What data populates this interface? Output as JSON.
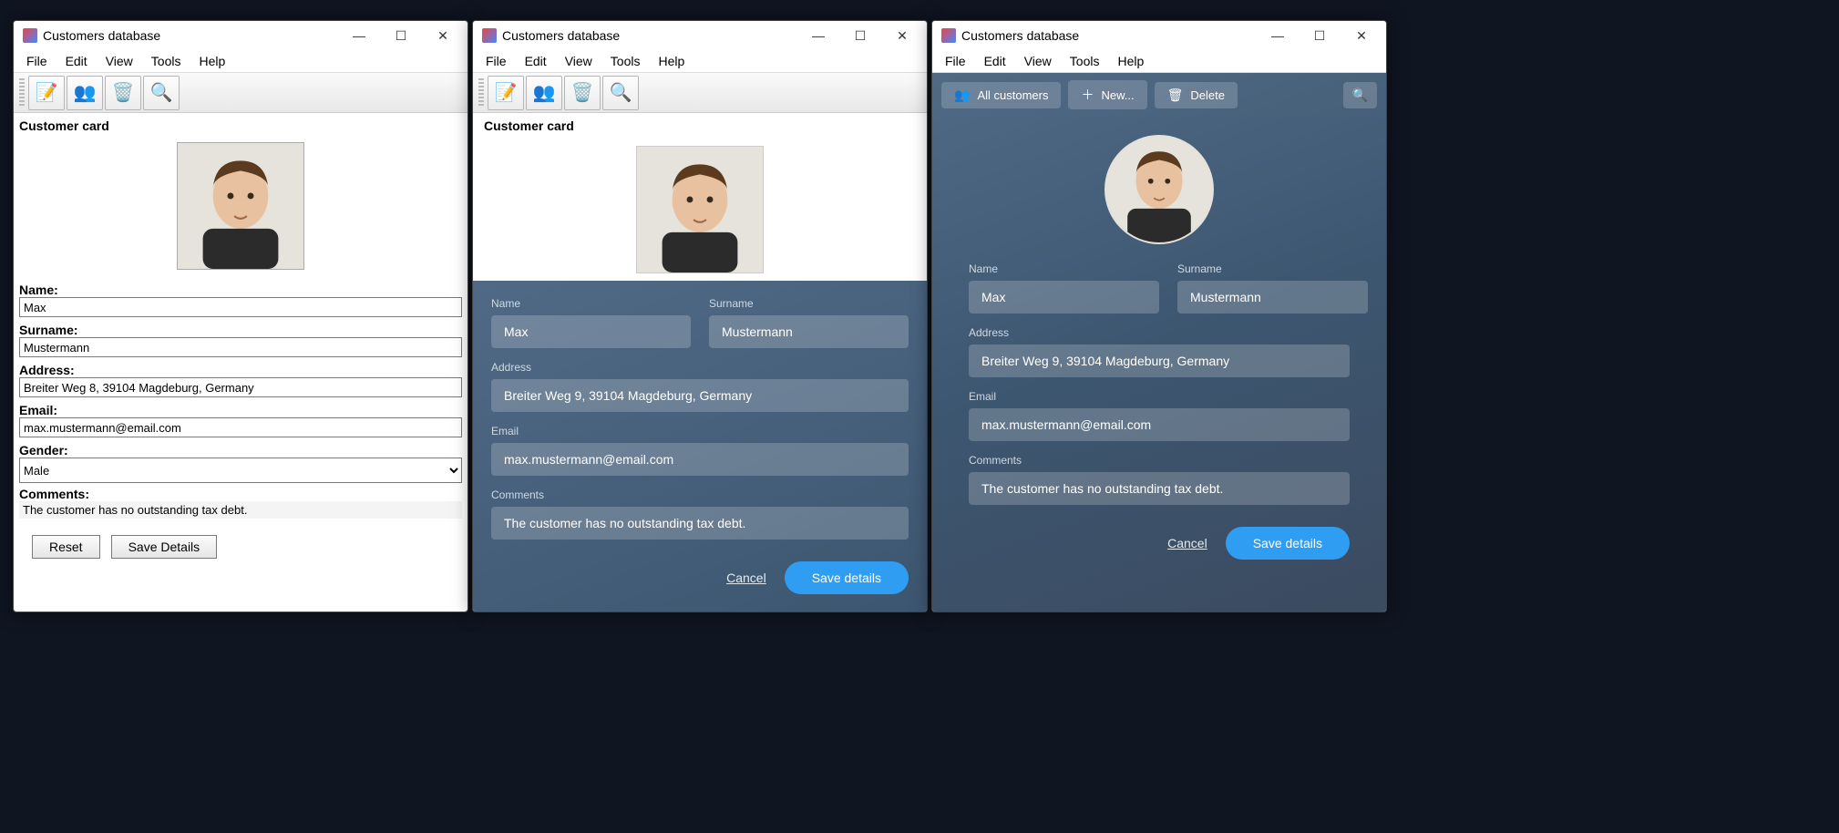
{
  "window_title": "Customers database",
  "menu": {
    "file": "File",
    "edit": "Edit",
    "view": "View",
    "tools": "Tools",
    "help": "Help"
  },
  "classic": {
    "section": "Customer card",
    "labels": {
      "name": "Name:",
      "surname": "Surname:",
      "address": "Address:",
      "email": "Email:",
      "gender": "Gender:",
      "comments": "Comments:"
    },
    "values": {
      "name": "Max",
      "surname": "Mustermann",
      "address": "Breiter Weg 8, 39104 Magdeburg, Germany",
      "email": "max.mustermann@email.com",
      "gender": "Male",
      "comments": "The customer has no outstanding tax debt."
    },
    "buttons": {
      "reset": "Reset",
      "save": "Save Details"
    }
  },
  "modern": {
    "section": "Customer card",
    "labels": {
      "name": "Name",
      "surname": "Surname",
      "address": "Address",
      "email": "Email",
      "comments": "Comments"
    },
    "values": {
      "name": "Max",
      "surname": "Mustermann",
      "address": "Breiter Weg 9, 39104 Magdeburg, Germany",
      "email": "max.mustermann@email.com",
      "comments": "The customer has no outstanding tax debt."
    },
    "buttons": {
      "cancel": "Cancel",
      "save": "Save details"
    }
  },
  "w3toolbar": {
    "all": "All customers",
    "new": "New...",
    "delete": "Delete"
  }
}
